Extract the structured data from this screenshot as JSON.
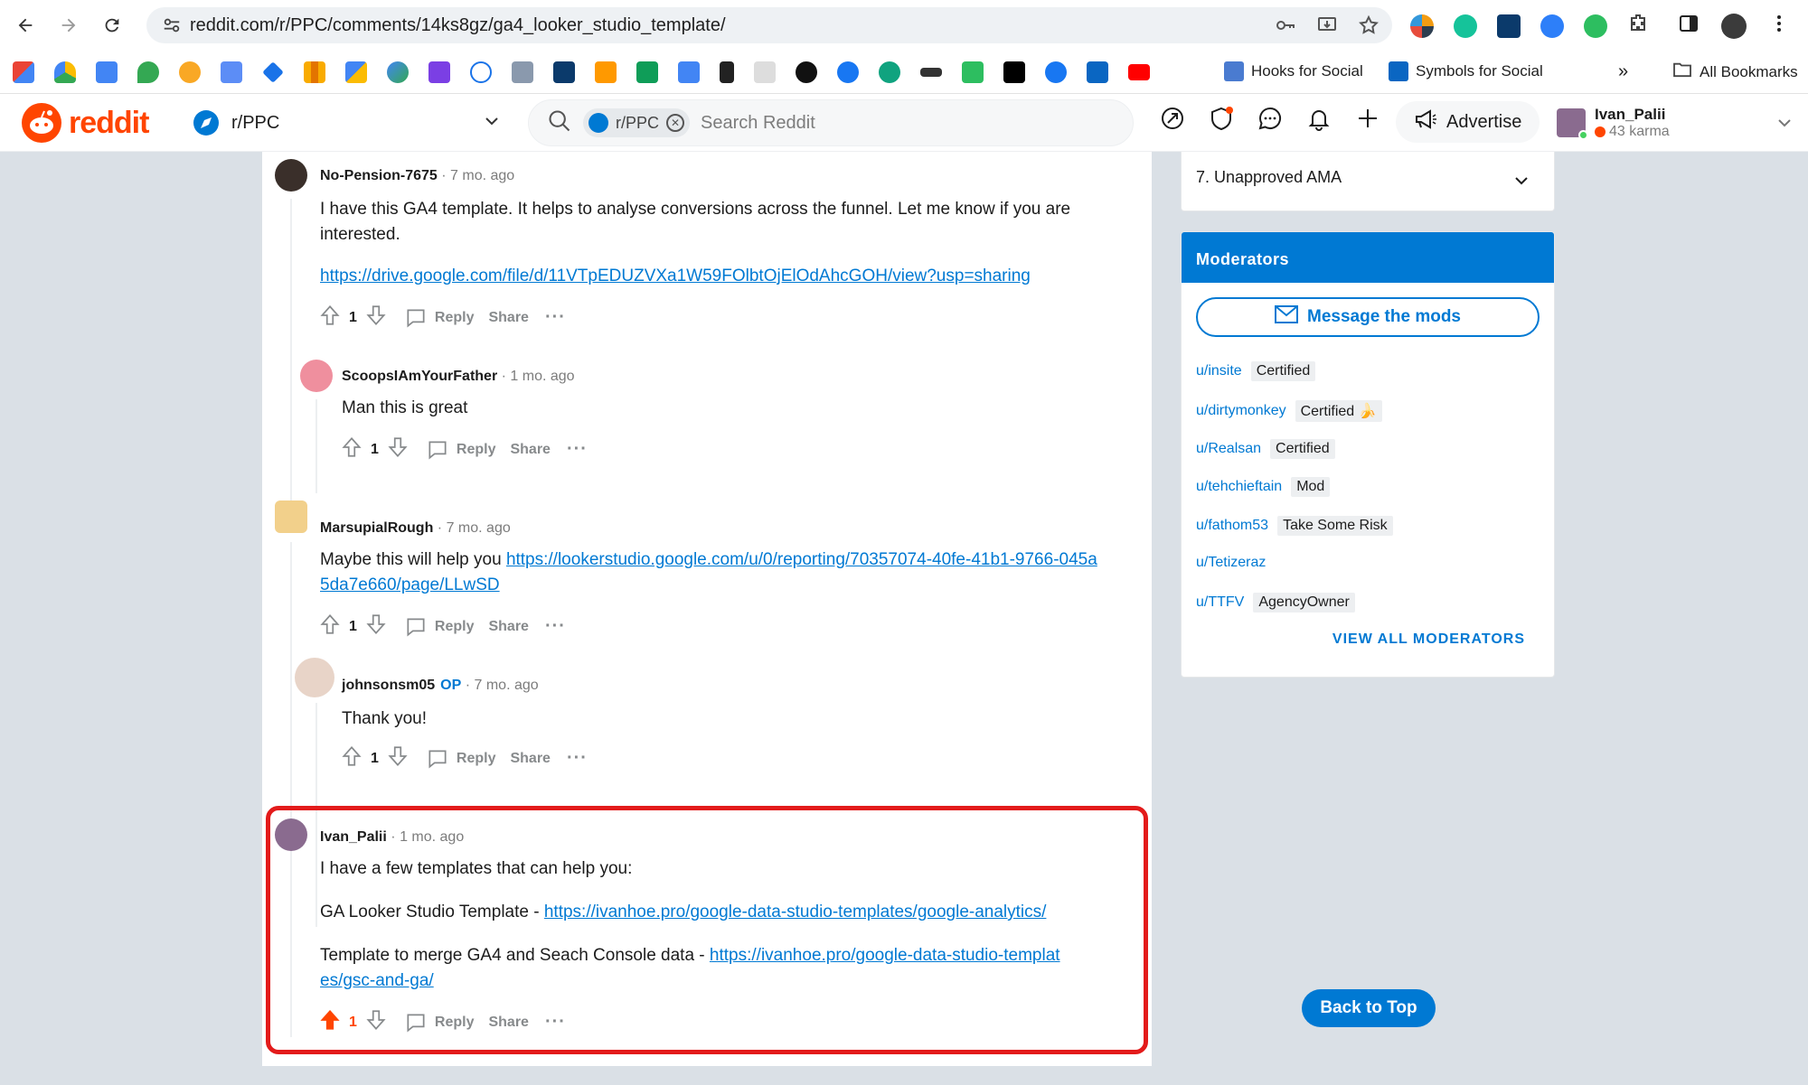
{
  "browser": {
    "url": "reddit.com/r/PPC/comments/14ks8gz/ga4_looker_studio_template/",
    "bookmarks": [
      {
        "label": "Hooks for Social",
        "color": "#4a7bd0"
      },
      {
        "label": "Symbols for Social",
        "color": "#0a66c2"
      }
    ],
    "all_bookmarks": "All Bookmarks",
    "overflow": "»"
  },
  "header": {
    "logo_text": "reddit",
    "community": "r/PPC",
    "search_chip": "r/PPC",
    "search_placeholder": "Search Reddit",
    "advertise": "Advertise",
    "user_name": "Ivan_Palii",
    "user_karma": "43 karma"
  },
  "comments": [
    {
      "author": "No-Pension-7675",
      "time": "7 mo. ago",
      "body": "I have this GA4 template. It helps to analyse conversions across the funnel. Let me know if you are interested.",
      "link": "https://drive.google.com/file/d/11VTpEDUZVXa1W59FOlbtOjElOdAhcGOH/view?usp=sharing",
      "votes": "1"
    },
    {
      "author": "ScoopsIAmYourFather",
      "time": "1 mo. ago",
      "body": "Man this is great",
      "votes": "1"
    },
    {
      "author": "MarsupialRough",
      "time": "7 mo. ago",
      "body_prefix": "Maybe this will help you ",
      "link": "https://lookerstudio.google.com/u/0/reporting/70357074-40fe-41b1-9766-045a5da7e660/page/LLwSD",
      "votes": "1"
    },
    {
      "author": "johnsonsm05",
      "op_label": "OP",
      "time": "7 mo. ago",
      "body": "Thank you!",
      "votes": "1"
    },
    {
      "author": "Ivan_Palii",
      "time": "1 mo. ago",
      "body": "I have a few templates that can help you:",
      "line2_prefix": "GA Looker Studio Template - ",
      "line2_link": "https://ivanhoe.pro/google-data-studio-templates/google-analytics/",
      "line3_prefix": "Template to merge GA4 and Seach Console data - ",
      "line3_link": "https://ivanhoe.pro/google-data-studio-templates/gsc-and-ga/",
      "votes": "1"
    }
  ],
  "actions": {
    "reply": "Reply",
    "share": "Share",
    "more": "···"
  },
  "rules": {
    "item": "7. Unapproved AMA"
  },
  "moderators": {
    "title": "Moderators",
    "message_button": "Message the mods",
    "list": [
      {
        "user": "u/insite",
        "flair": "Certified"
      },
      {
        "user": "u/dirtymonkey",
        "flair": "Certified 🍌"
      },
      {
        "user": "u/Realsan",
        "flair": "Certified"
      },
      {
        "user": "u/tehchieftain",
        "flair": "Mod"
      },
      {
        "user": "u/fathom53",
        "flair": "Take Some Risk"
      },
      {
        "user": "u/Tetizeraz",
        "flair": ""
      },
      {
        "user": "u/TTFV",
        "flair": "AgencyOwner"
      }
    ],
    "view_all": "VIEW ALL MODERATORS"
  },
  "back_to_top": "Back to Top",
  "colors": {
    "brand": "#ff4500",
    "link": "#0079d3",
    "highlight": "#e31b1b"
  }
}
